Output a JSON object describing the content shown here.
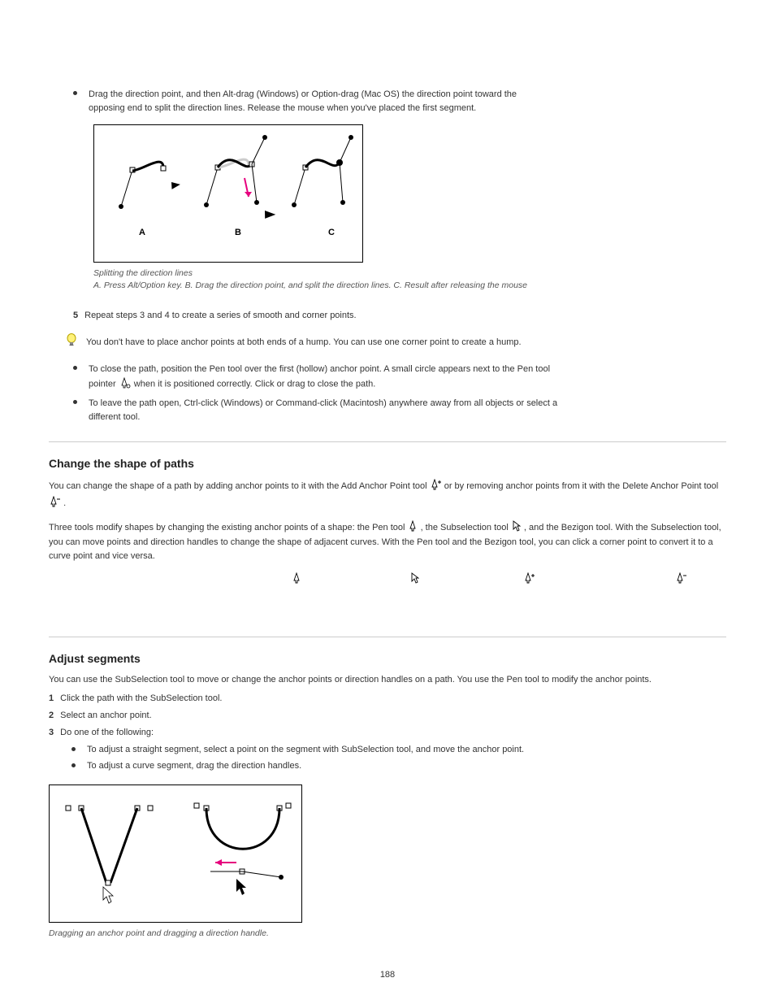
{
  "top": {
    "bullet1_a": "Drag the direction point, and then Alt-drag (Windows) or Option-drag (Mac OS) the direction point toward the",
    "bullet1_b": "opposing end to split the direction lines. Release the mouse when you've placed the first segment.",
    "fig1_caption_a": "Splitting the direction lines",
    "fig1_caption_b": "A. Press Alt/Option key.  B. Drag the direction point, and split the direction lines.  C. Result after releasing the mouse",
    "label_A": "A",
    "label_B": "B",
    "label_C": "C",
    "step5": "5",
    "step5_text": "Repeat steps 3 and 4 to create a series of smooth and corner points."
  },
  "tip": {
    "text": "You don't have to place anchor points at both ends of a hump. You can use one corner point to create a hump."
  },
  "close_list": {
    "item1_a": "To close the path, position the Pen tool over the first (hollow) anchor point. A small circle appears next to the Pen tool",
    "item1_b": "pointer",
    "item1_c": " when it is positioned correctly. Click or drag to close the path.",
    "item2_a": "To leave the path open, Ctrl-click (Windows) or Command-click (Macintosh) anywhere away from all objects or select a",
    "item2_b": "different tool."
  },
  "section2": {
    "title": "Change the shape of paths",
    "p1_a": "You can change the shape of a path by adding anchor points to it with the Add Anchor Point tool ",
    "p1_b": " or by removing anchor points from it with the Delete Anchor Point tool ",
    "p1_c": ".",
    "p2_a": "Three tools modify shapes by changing the existing anchor points of a shape: the Pen tool ",
    "p2_b": ", the Subselection tool ",
    "p2_c": ", and the Bezigon tool. With the Subselection tool, you can move points and direction handles to change the shape of adjacent curves. With the Pen tool and the Bezigon tool, you can click a corner point to convert it to a curve point and vice versa."
  },
  "section3": {
    "title": "Adjust segments",
    "p1": "You can use the SubSelection tool to move or change the anchor points or direction handles on a path. You use the Pen tool to modify the anchor points.",
    "step1_num": "1",
    "step1_text": "Click the path with the SubSelection tool.",
    "step2_num": "2",
    "step2_text": "Select an anchor point.",
    "step3_num": "3",
    "step3_text": "Do one of the following:",
    "sub_a": "To adjust a straight segment, select a point on the segment with SubSelection tool, and move the anchor point.",
    "sub_b": "To adjust a curve segment, drag the direction handles.",
    "fig2_caption": "Dragging an anchor point and dragging a direction handle."
  },
  "page_number": "188"
}
